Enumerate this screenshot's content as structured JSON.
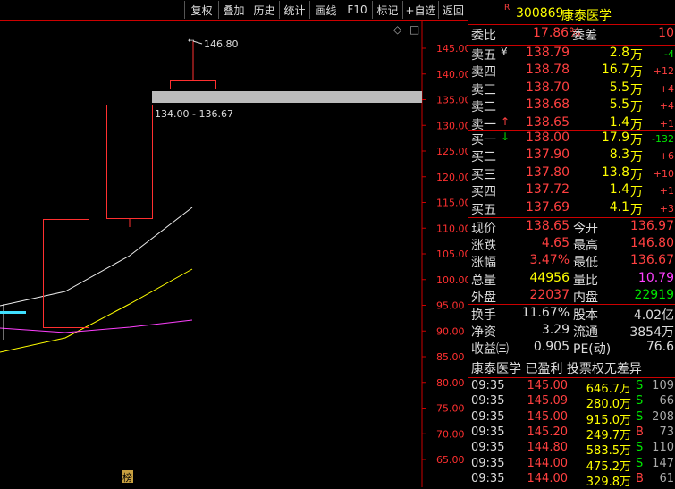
{
  "toolbar": {
    "buttons": [
      "复权",
      "叠加",
      "历史",
      "统计",
      "画线",
      "F10",
      "标记",
      "+自选",
      "返回"
    ]
  },
  "chart": {
    "axis_labels": [
      "145.00",
      "140.00",
      "135.00",
      "130.00",
      "125.00",
      "120.00",
      "115.00",
      "110.00",
      "105.00",
      "100.00",
      "95.00",
      "90.00",
      "85.00",
      "80.00",
      "75.00",
      "70.00",
      "65.00"
    ],
    "high_label": "146.80",
    "gap_label": "134.00 - 136.67",
    "bottom_marker": "榜",
    "corner_icons": [
      "◇",
      "□"
    ]
  },
  "header": {
    "badge": "R",
    "code": "300869",
    "name": "康泰医学"
  },
  "weibi": {
    "label1": "委比",
    "value1": "17.86%",
    "label2": "委差",
    "value2": "10"
  },
  "asks": [
    {
      "label": "卖五",
      "sym": "¥",
      "price": "138.79",
      "vol": "2.8",
      "unit": "万",
      "chg": "-4"
    },
    {
      "label": "卖四",
      "sym": "",
      "price": "138.78",
      "vol": "16.7",
      "unit": "万",
      "chg": "+12"
    },
    {
      "label": "卖三",
      "sym": "",
      "price": "138.70",
      "vol": "5.5",
      "unit": "万",
      "chg": "+4"
    },
    {
      "label": "卖二",
      "sym": "",
      "price": "138.68",
      "vol": "5.5",
      "unit": "万",
      "chg": "+4"
    },
    {
      "label": "卖一",
      "sym": "↑",
      "price": "138.65",
      "vol": "1.4",
      "unit": "万",
      "chg": "+1"
    }
  ],
  "bids": [
    {
      "label": "买一",
      "sym": "↓",
      "price": "138.00",
      "vol": "17.9",
      "unit": "万",
      "chg": "-132"
    },
    {
      "label": "买二",
      "sym": "",
      "price": "137.90",
      "vol": "8.3",
      "unit": "万",
      "chg": "+6"
    },
    {
      "label": "买三",
      "sym": "",
      "price": "137.80",
      "vol": "13.8",
      "unit": "万",
      "chg": "+10"
    },
    {
      "label": "买四",
      "sym": "",
      "price": "137.72",
      "vol": "1.4",
      "unit": "万",
      "chg": "+1"
    },
    {
      "label": "买五",
      "sym": "",
      "price": "137.69",
      "vol": "4.1",
      "unit": "万",
      "chg": "+3"
    }
  ],
  "quote": [
    {
      "l1": "现价",
      "v1": "138.65",
      "l2": "今开",
      "v2": "136.97"
    },
    {
      "l1": "涨跌",
      "v1": "4.65",
      "l2": "最高",
      "v2": "146.80"
    },
    {
      "l1": "涨幅",
      "v1": "3.47%",
      "l2": "最低",
      "v2": "136.67"
    },
    {
      "l1": "总量",
      "v1": "44956",
      "l2": "量比",
      "v2": "10.79"
    },
    {
      "l1": "外盘",
      "v1": "22037",
      "l2": "内盘",
      "v2": "22919"
    }
  ],
  "fundamentals": [
    {
      "l1": "换手",
      "v1": "11.67%",
      "l2": "股本",
      "v2": "4.02亿"
    },
    {
      "l1": "净资",
      "v1": "3.29",
      "l2": "流通",
      "v2": "3854万"
    },
    {
      "l1": "收益㈢",
      "v1": "0.905",
      "l2": "PE(动)",
      "v2": "76.6"
    }
  ],
  "tags_line": "康泰医学 已盈利 投票权无差异",
  "ticks": [
    {
      "time": "09:35",
      "price": "145.00",
      "vol": "646.7万",
      "bs": "S",
      "n": "109"
    },
    {
      "time": "09:35",
      "price": "145.09",
      "vol": "280.0万",
      "bs": "S",
      "n": "66"
    },
    {
      "time": "09:35",
      "price": "145.00",
      "vol": "915.0万",
      "bs": "S",
      "n": "208"
    },
    {
      "time": "09:35",
      "price": "145.20",
      "vol": "249.7万",
      "bs": "B",
      "n": "73"
    },
    {
      "time": "09:35",
      "price": "144.80",
      "vol": "583.5万",
      "bs": "S",
      "n": "110"
    },
    {
      "time": "09:35",
      "price": "144.00",
      "vol": "475.2万",
      "bs": "S",
      "n": "147"
    },
    {
      "time": "09:35",
      "price": "144.00",
      "vol": "329.8万",
      "bs": "B",
      "n": "61"
    }
  ]
}
